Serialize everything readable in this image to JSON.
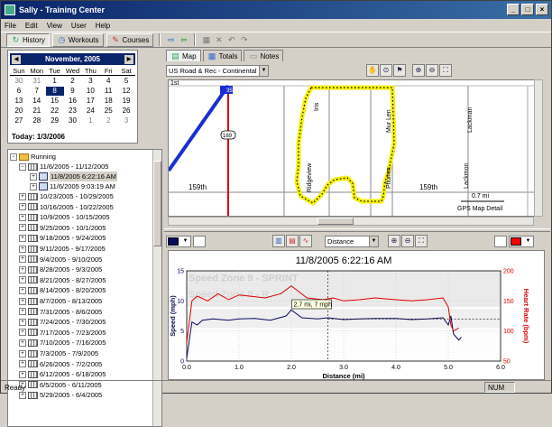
{
  "window": {
    "title": "Sally - Training Center"
  },
  "menu": [
    "File",
    "Edit",
    "View",
    "User",
    "Help"
  ],
  "toolbar": {
    "history": "History",
    "workouts": "Workouts",
    "courses": "Courses"
  },
  "calendar": {
    "month": "November, 2005",
    "days": [
      "Sun",
      "Mon",
      "Tue",
      "Wed",
      "Thu",
      "Fri",
      "Sat"
    ],
    "cells": [
      "30",
      "31",
      "1",
      "2",
      "3",
      "4",
      "5",
      "6",
      "7",
      "8",
      "9",
      "10",
      "11",
      "12",
      "13",
      "14",
      "15",
      "16",
      "17",
      "18",
      "19",
      "20",
      "21",
      "22",
      "23",
      "24",
      "25",
      "26",
      "27",
      "28",
      "29",
      "30",
      "1",
      "2",
      "3"
    ],
    "selected": "8",
    "today": "Today: 1/3/2006"
  },
  "tree": {
    "root": "Running",
    "week_open": "11/6/2005 - 11/12/2005",
    "activities": [
      "11/8/2005 6:22:16 AM",
      "11/6/2005 9:03:19 AM"
    ],
    "weeks": [
      "10/23/2005 - 10/29/2005",
      "10/16/2005 - 10/22/2005",
      "10/9/2005 - 10/15/2005",
      "9/25/2005 - 10/1/2005",
      "9/18/2005 - 9/24/2005",
      "9/11/2005 - 9/17/2005",
      "9/4/2005 - 9/10/2005",
      "8/28/2005 - 9/3/2005",
      "8/21/2005 - 8/27/2005",
      "8/14/2005 - 8/20/2005",
      "8/7/2005 - 8/13/2005",
      "7/31/2005 - 8/6/2005",
      "7/24/2005 - 7/30/2005",
      "7/17/2005 - 7/23/2005",
      "7/10/2005 - 7/16/2005",
      "7/3/2005 - 7/9/2005",
      "6/26/2005 - 7/2/2005",
      "6/12/2005 - 6/18/2005",
      "6/5/2005 - 6/11/2005",
      "5/29/2005 - 6/4/2005"
    ]
  },
  "map": {
    "tabs": [
      "Map",
      "Totals",
      "Notes"
    ],
    "layer": "US Road & Rec - Continental US",
    "streets": {
      "first": "1st",
      "interstate": "35",
      "route": "169",
      "south_street": "159th",
      "south_street_right": "159th",
      "mur_len": "Mur Len",
      "pflumm": "Pflumm",
      "lackman": "Lackman",
      "ridgeview": "Ridgeview",
      "lackmon": "Lackmon",
      "iris": "Iris"
    },
    "scale": "0.7 mi",
    "detail": "GPS Map Detail"
  },
  "chart": {
    "axis_select": "Distance",
    "left_color": "#0a0a60",
    "right_color": "#ff0000"
  },
  "chart_data": {
    "type": "line",
    "title": "11/8/2005 6:22:16 AM",
    "xlabel": "Distance (mi)",
    "ylabel": "Speed (mph)",
    "y2label": "Heart Rate (bpm)",
    "xlim": [
      0.0,
      6.0
    ],
    "ylim": [
      0,
      15
    ],
    "y2lim": [
      50,
      200
    ],
    "xticks": [
      "0.0",
      "1.0",
      "2.0",
      "3.0",
      "4.0",
      "5.0",
      "6.0"
    ],
    "yticks": [
      "0",
      "5",
      "10",
      "15"
    ],
    "y2ticks": [
      "50",
      "100",
      "150",
      "200"
    ],
    "zone_labels": [
      "Speed Zone 9 - SPRINT",
      "Speed Zone 8 - R"
    ],
    "tooltip": "2.7 mi, 7 mph",
    "cursor_x": 2.7,
    "series": [
      {
        "name": "Speed",
        "color": "#0a0a60",
        "x": [
          0.0,
          0.1,
          0.2,
          0.3,
          0.5,
          0.8,
          1.0,
          1.3,
          1.6,
          1.9,
          2.0,
          2.2,
          2.5,
          2.7,
          3.0,
          3.3,
          3.6,
          4.0,
          4.3,
          4.6,
          4.9,
          5.0,
          5.05,
          5.1,
          5.2,
          5.25
        ],
        "y": [
          0.5,
          6.5,
          6.0,
          6.8,
          7.0,
          6.8,
          7.0,
          7.1,
          6.8,
          7.5,
          8.5,
          7.2,
          7.0,
          7.2,
          6.9,
          7.0,
          7.1,
          7.1,
          6.9,
          7.0,
          7.2,
          6.0,
          7.5,
          4.5,
          3.5,
          4.0
        ]
      },
      {
        "name": "Heart Rate",
        "color": "#e00000",
        "x": [
          0.0,
          0.1,
          0.2,
          0.4,
          0.6,
          0.8,
          1.0,
          1.2,
          1.5,
          1.8,
          2.0,
          2.3,
          2.6,
          2.8,
          3.0,
          3.3,
          3.6,
          4.0,
          4.3,
          4.6,
          4.9,
          5.0,
          5.05,
          5.1,
          5.2
        ],
        "y": [
          80,
          150,
          158,
          150,
          162,
          152,
          160,
          158,
          155,
          162,
          175,
          155,
          152,
          155,
          150,
          152,
          155,
          152,
          150,
          152,
          155,
          140,
          110,
          100,
          105
        ]
      }
    ]
  },
  "status": {
    "left": "Ready",
    "num": "NUM"
  }
}
